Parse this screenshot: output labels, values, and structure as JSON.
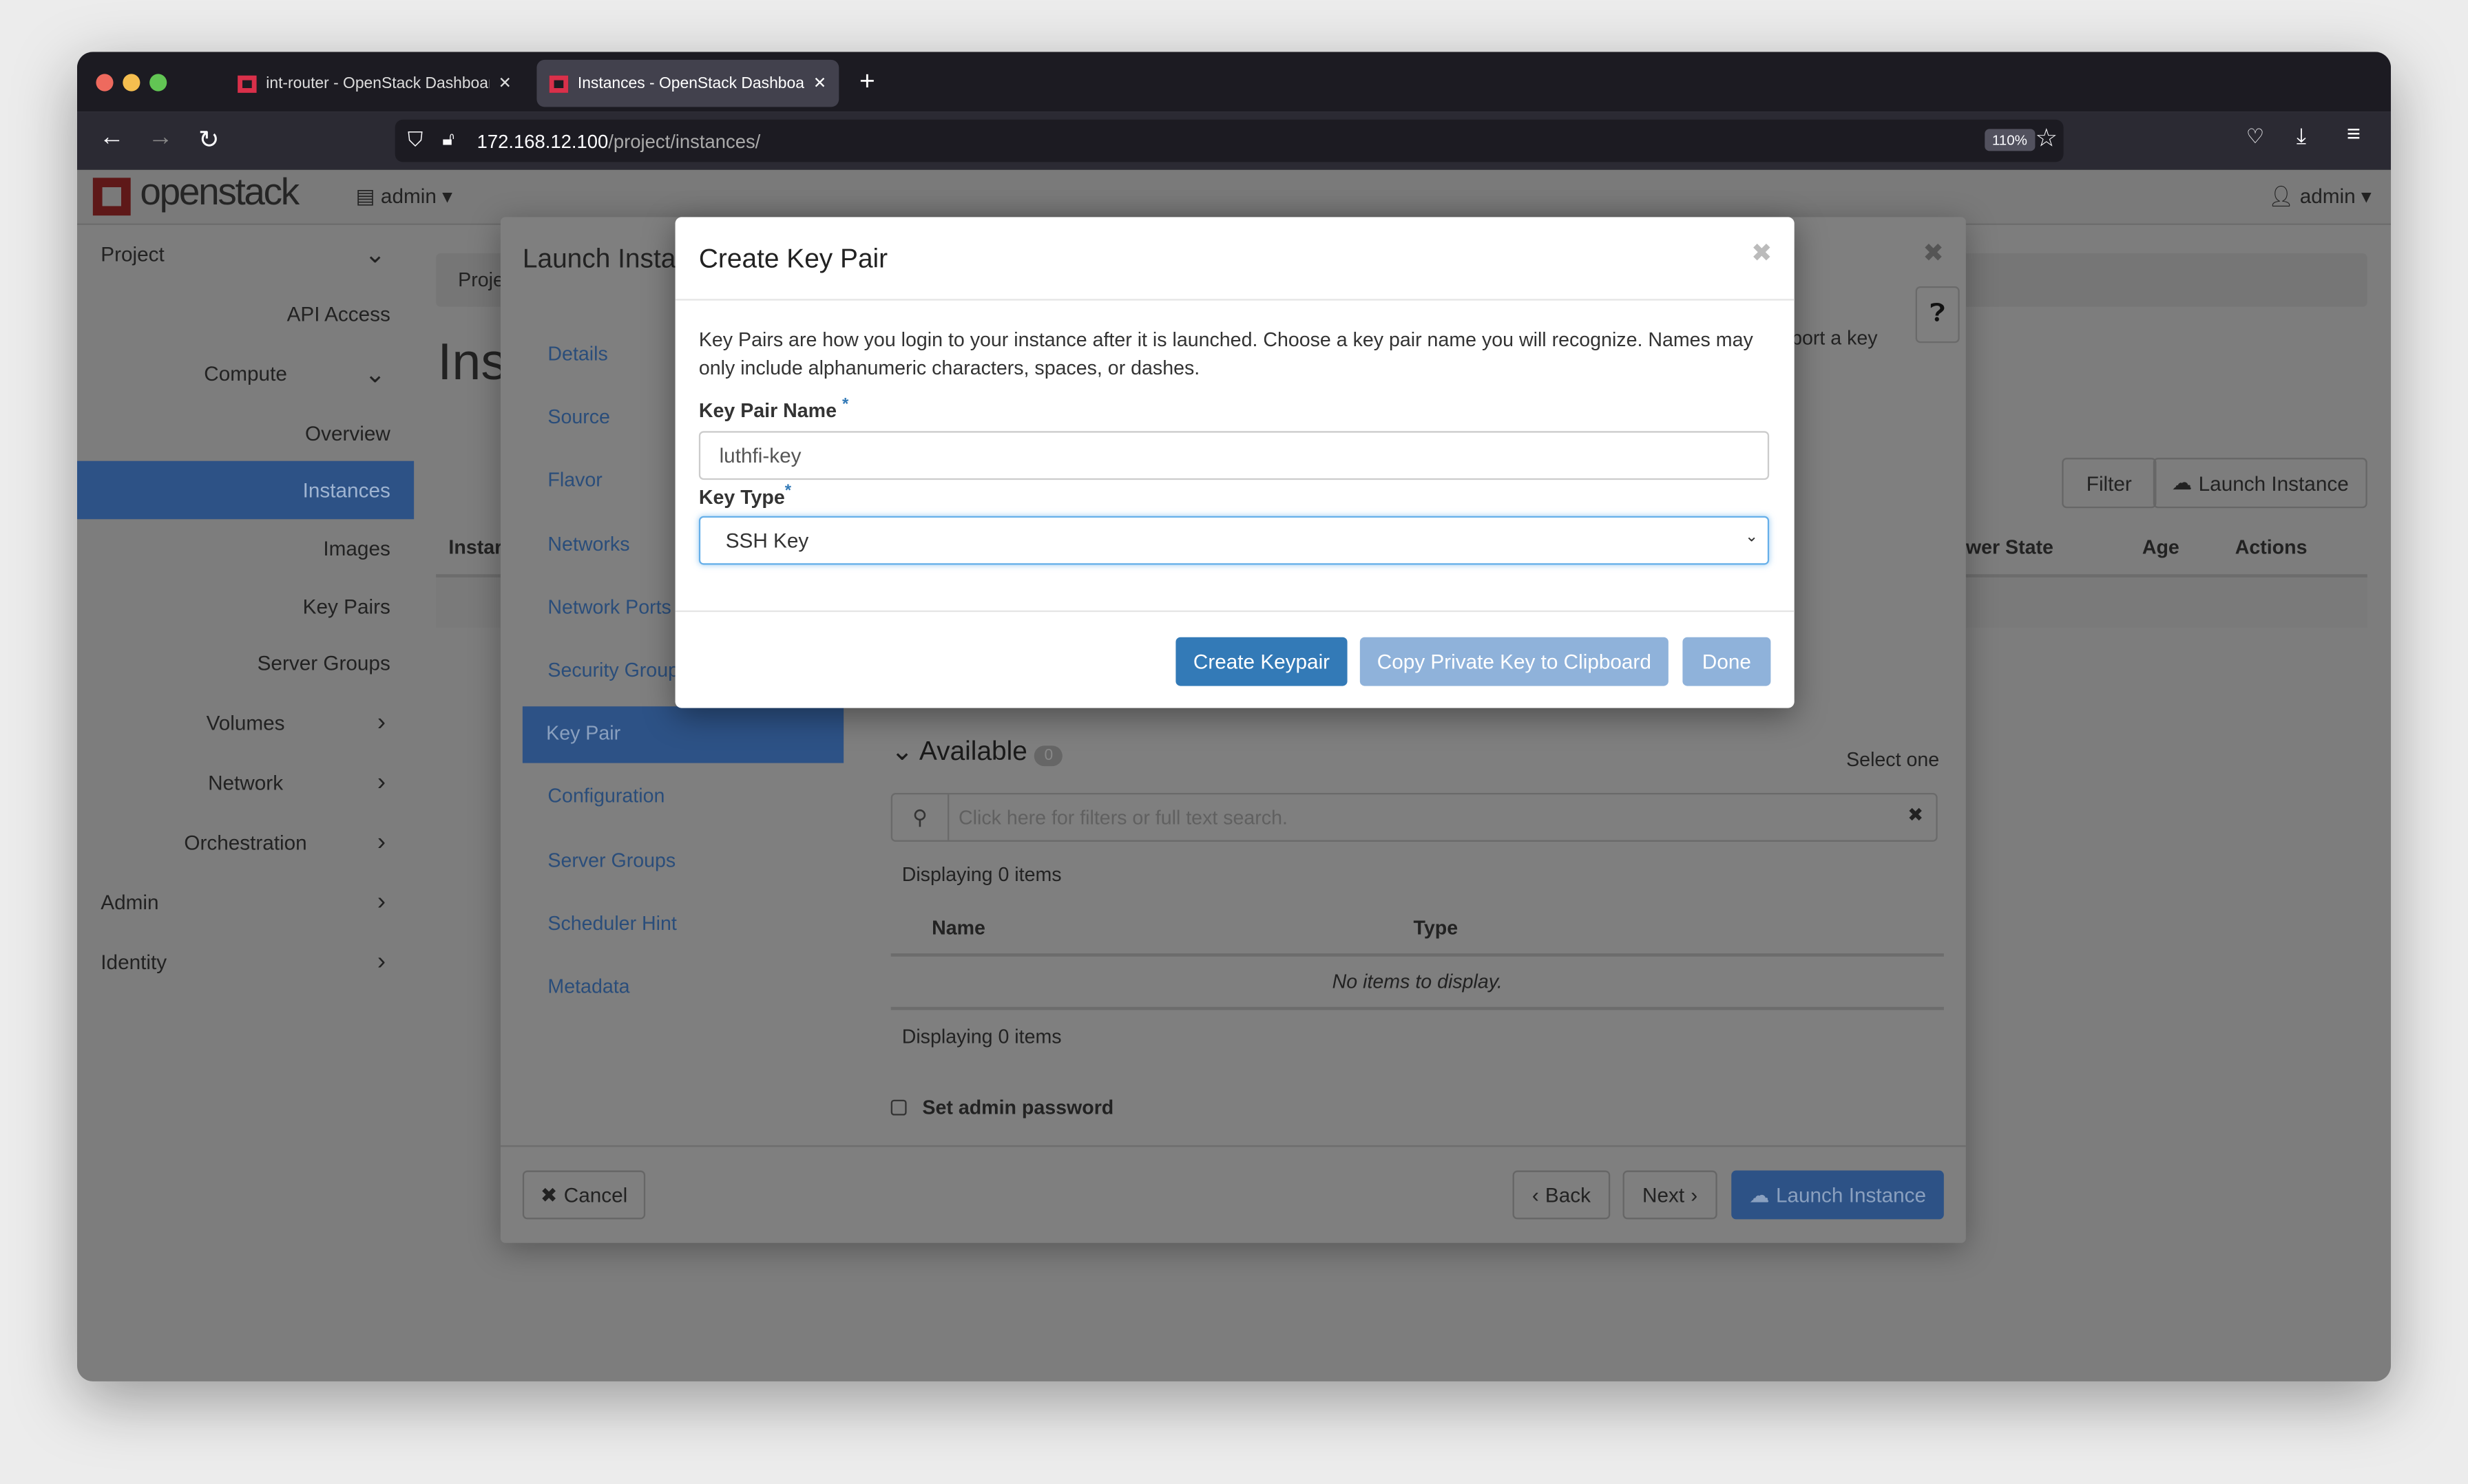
{
  "browser": {
    "tabs": [
      {
        "title": "int-router - OpenStack Dashboard",
        "active": false
      },
      {
        "title": "Instances - OpenStack Dashboard",
        "active": true
      }
    ],
    "new_tab": "+",
    "url_host": "172.168.12.100",
    "url_path": "/project/instances/",
    "zoom": "110%"
  },
  "header": {
    "logo": "openstack",
    "project": "admin",
    "user": "admin"
  },
  "sidebar": {
    "items": [
      {
        "label": "Project",
        "level": 0,
        "chevron": "down"
      },
      {
        "label": "API Access",
        "level": 2
      },
      {
        "label": "Compute",
        "level": 1,
        "chevron": "down"
      },
      {
        "label": "Overview",
        "level": 2
      },
      {
        "label": "Instances",
        "level": 2,
        "active": true
      },
      {
        "label": "Images",
        "level": 2
      },
      {
        "label": "Key Pairs",
        "level": 2
      },
      {
        "label": "Server Groups",
        "level": 2
      },
      {
        "label": "Volumes",
        "level": 1,
        "chevron": "right"
      },
      {
        "label": "Network",
        "level": 1,
        "chevron": "right"
      },
      {
        "label": "Orchestration",
        "level": 1,
        "chevron": "right"
      },
      {
        "label": "Admin",
        "level": 0,
        "chevron": "right"
      },
      {
        "label": "Identity",
        "level": 0,
        "chevron": "right"
      }
    ]
  },
  "page": {
    "breadcrumb": "Proje",
    "title": "Ins",
    "filter": "Filter",
    "launch": "Launch Instance",
    "cols": [
      "Instar",
      "wer State",
      "Age",
      "Actions"
    ]
  },
  "launch_modal": {
    "title": "Launch Insta",
    "nav": [
      "Details",
      "Source",
      "Flavor",
      "Networks",
      "Network Ports",
      "Security Groups",
      "Key Pair",
      "Configuration",
      "Server Groups",
      "Scheduler Hints",
      "Metadata"
    ],
    "active": "Key Pair",
    "side_text": "port a key",
    "available": "Available",
    "available_count": "0",
    "select_one": "Select one",
    "search_placeholder": "Click here for filters or full text search.",
    "displaying": "Displaying 0 items",
    "col_name": "Name",
    "col_type": "Type",
    "empty": "No items to display.",
    "displaying2": "Displaying 0 items",
    "set_admin_password": "Set admin password",
    "cancel": "Cancel",
    "back": "Back",
    "next": "Next",
    "launch": "Launch Instance"
  },
  "dialog": {
    "title": "Create Key Pair",
    "description": "Key Pairs are how you login to your instance after it is launched. Choose a key pair name you will recognize. Names may only include alphanumeric characters, spaces, or dashes.",
    "name_label": "Key Pair Name",
    "name_value": "luthfi-key",
    "type_label": "Key Type",
    "type_value": "SSH Key",
    "required": "*",
    "create": "Create Keypair",
    "copy": "Copy Private Key to Clipboard",
    "done": "Done"
  },
  "colors": {
    "primary": "#337ab7",
    "disabled_primary": "#8fb2da",
    "active_dimmed": "#2d5286"
  }
}
